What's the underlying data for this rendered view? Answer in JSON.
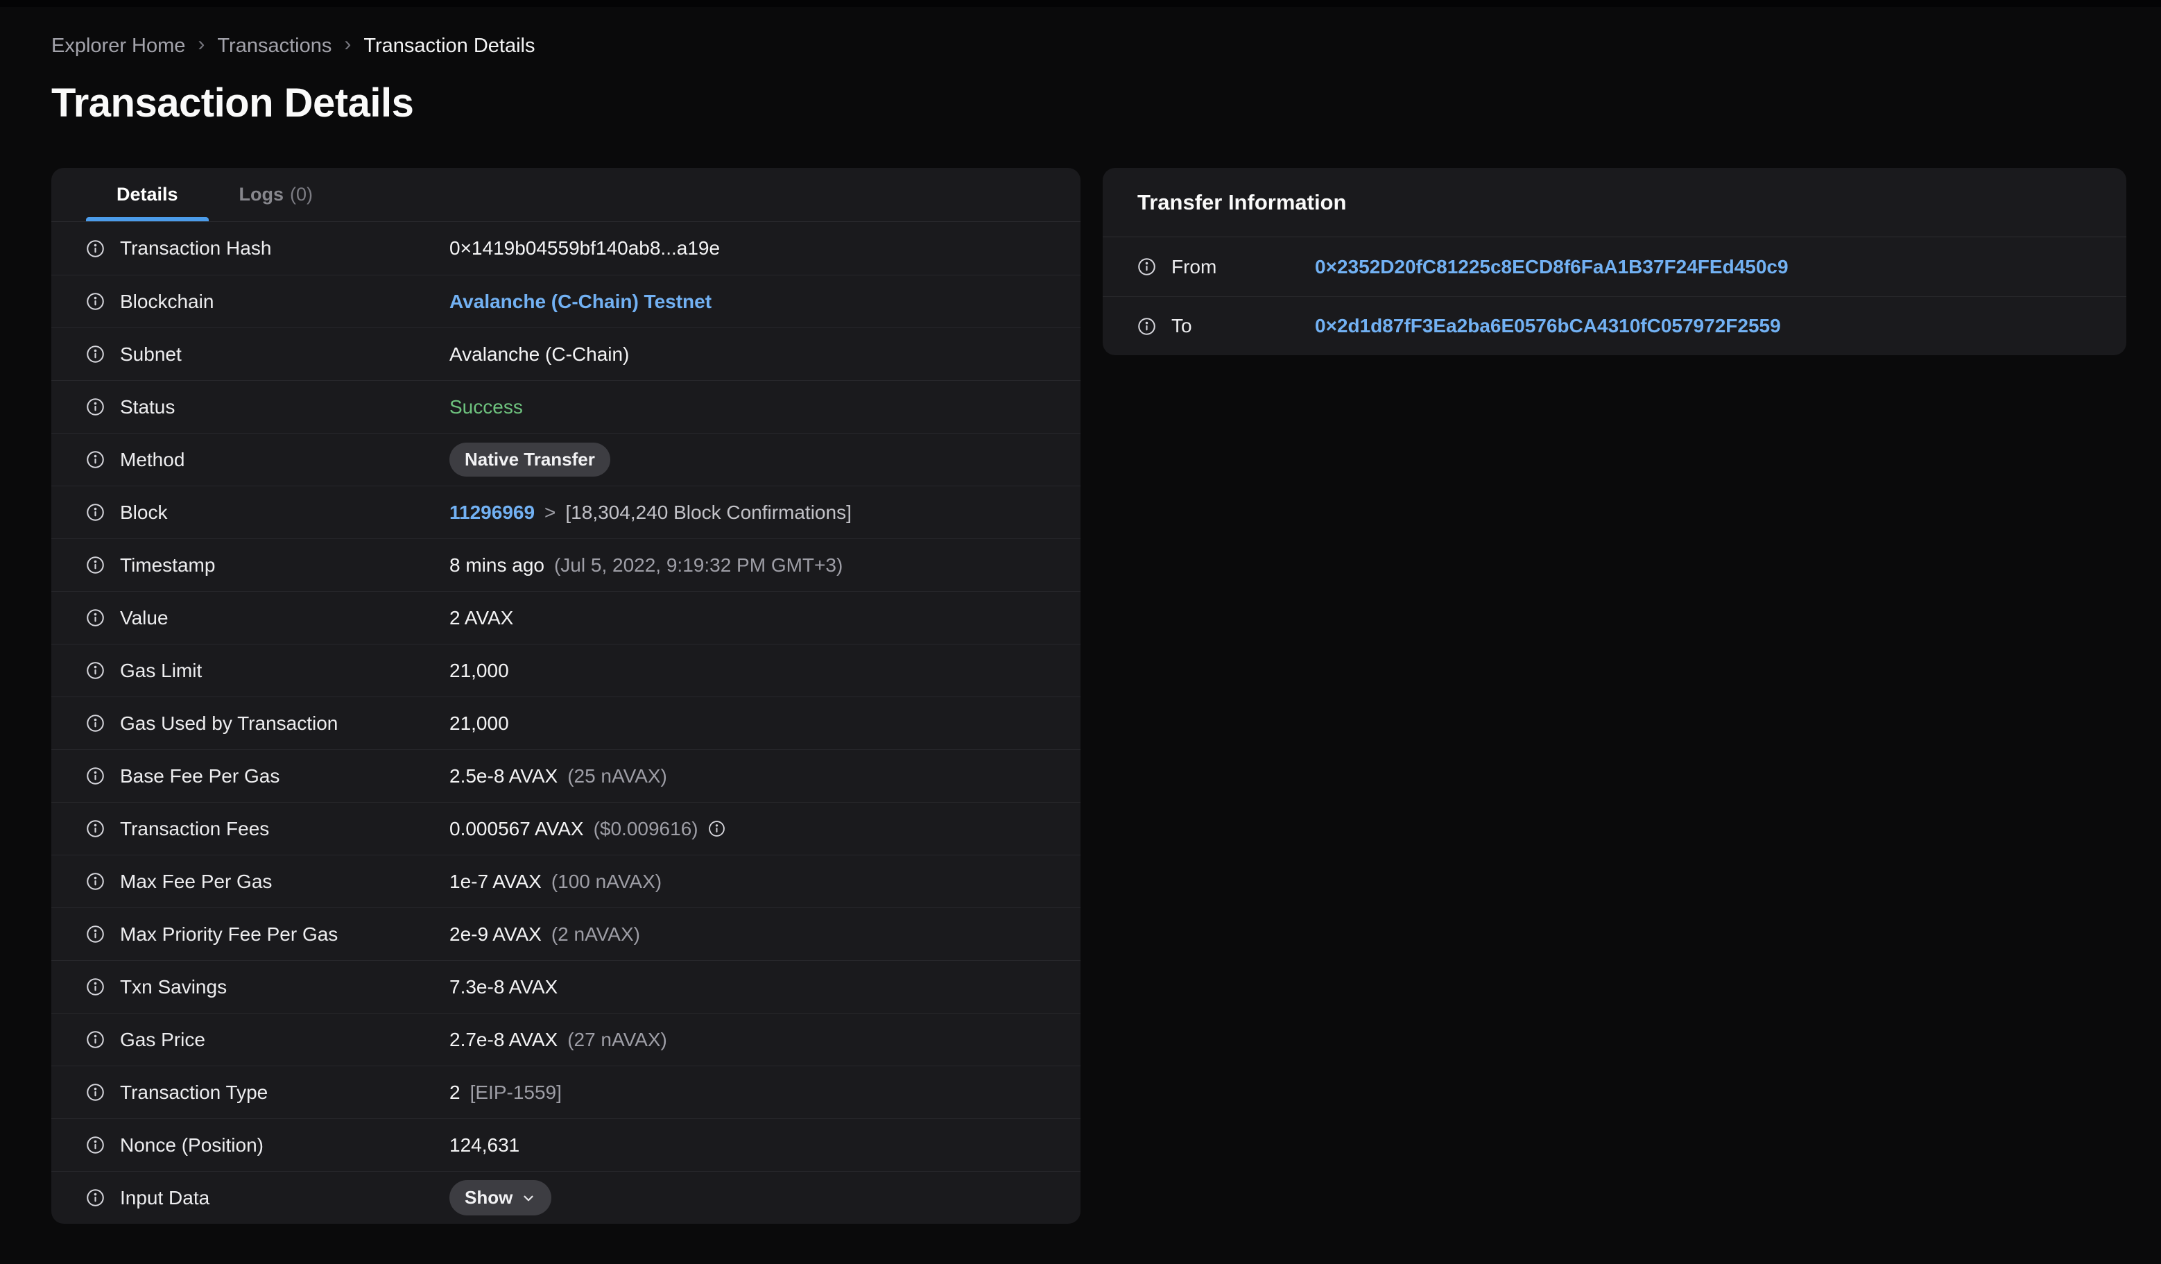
{
  "breadcrumb": {
    "separator": "›",
    "items": [
      {
        "label": "Explorer Home",
        "current": false
      },
      {
        "label": "Transactions",
        "current": false
      },
      {
        "label": "Transaction Details",
        "current": true
      }
    ]
  },
  "page": {
    "title": "Transaction Details"
  },
  "details_card": {
    "tabs": [
      {
        "label": "Details",
        "count": "",
        "active": true
      },
      {
        "label": "Logs",
        "count": "(0)",
        "active": false
      }
    ],
    "rows": [
      {
        "key": "transaction-hash",
        "label": "Transaction Hash",
        "type": "text",
        "value": "0×1419b04559bf140ab8...a19e"
      },
      {
        "key": "blockchain",
        "label": "Blockchain",
        "type": "link",
        "value": "Avalanche (C-Chain) Testnet"
      },
      {
        "key": "subnet",
        "label": "Subnet",
        "type": "text",
        "value": "Avalanche (C-Chain)"
      },
      {
        "key": "status",
        "label": "Status",
        "type": "status",
        "value": "Success"
      },
      {
        "key": "method",
        "label": "Method",
        "type": "badge",
        "value": "Native Transfer"
      },
      {
        "key": "block",
        "label": "Block",
        "type": "link-extra",
        "value": "11296969",
        "separator": ">",
        "secondary": "[18,304,240 Block Confirmations]"
      },
      {
        "key": "timestamp",
        "label": "Timestamp",
        "type": "text",
        "value": "8 mins ago",
        "secondary": "(Jul 5, 2022, 9:19:32 PM GMT+3)"
      },
      {
        "key": "value",
        "label": "Value",
        "type": "text",
        "value": "2 AVAX"
      },
      {
        "key": "gas-limit",
        "label": "Gas Limit",
        "type": "text",
        "value": "21,000"
      },
      {
        "key": "gas-used-by-transaction",
        "label": "Gas Used by Transaction",
        "type": "text",
        "value": "21,000"
      },
      {
        "key": "base-fee-per-gas",
        "label": "Base Fee Per Gas",
        "type": "text",
        "value": "2.5e-8 AVAX",
        "secondary": "(25 nAVAX)"
      },
      {
        "key": "transaction-fees",
        "label": "Transaction Fees",
        "type": "text",
        "value": "0.000567 AVAX",
        "secondary": "($0.009616)",
        "trailing_info_icon": true
      },
      {
        "key": "max-fee-per-gas",
        "label": "Max Fee Per Gas",
        "type": "text",
        "value": "1e-7 AVAX",
        "secondary": "(100 nAVAX)"
      },
      {
        "key": "max-priority-fee-per-gas",
        "label": "Max Priority Fee Per Gas",
        "type": "text",
        "value": "2e-9 AVAX",
        "secondary": "(2 nAVAX)"
      },
      {
        "key": "txn-savings",
        "label": "Txn Savings",
        "type": "text",
        "value": "7.3e-8 AVAX"
      },
      {
        "key": "gas-price",
        "label": "Gas Price",
        "type": "text",
        "value": "2.7e-8 AVAX",
        "secondary": "(27 nAVAX)"
      },
      {
        "key": "transaction-type",
        "label": "Transaction Type",
        "type": "text",
        "value": "2",
        "secondary": "[EIP-1559]"
      },
      {
        "key": "nonce-position",
        "label": "Nonce (Position)",
        "type": "text",
        "value": "124,631"
      },
      {
        "key": "input-data",
        "label": "Input Data",
        "type": "button",
        "value": "Show"
      }
    ]
  },
  "transfer_card": {
    "title": "Transfer Information",
    "rows": [
      {
        "key": "from",
        "label": "From",
        "value": "0×2352D20fC81225c8ECD8f6FaA1B37F24FEd450c9"
      },
      {
        "key": "to",
        "label": "To",
        "value": "0×2d1d87fF3Ea2ba6E0576bCA4310fC057972F2559"
      }
    ]
  },
  "colors": {
    "page_background": "#0a0a0b",
    "card_background": "#1a1a1d",
    "separator": "#27272b",
    "accent_blue_underline": "#4c9cea",
    "link_blue": "#72b1f3",
    "success_green": "#6ec27e",
    "secondary_text": "#9e9ea6",
    "pill_background": "#3d3d42"
  },
  "icons": {
    "info": "info-icon",
    "chevron_down": "chevron-down-icon",
    "breadcrumb_separator": "chevron-right-icon"
  }
}
